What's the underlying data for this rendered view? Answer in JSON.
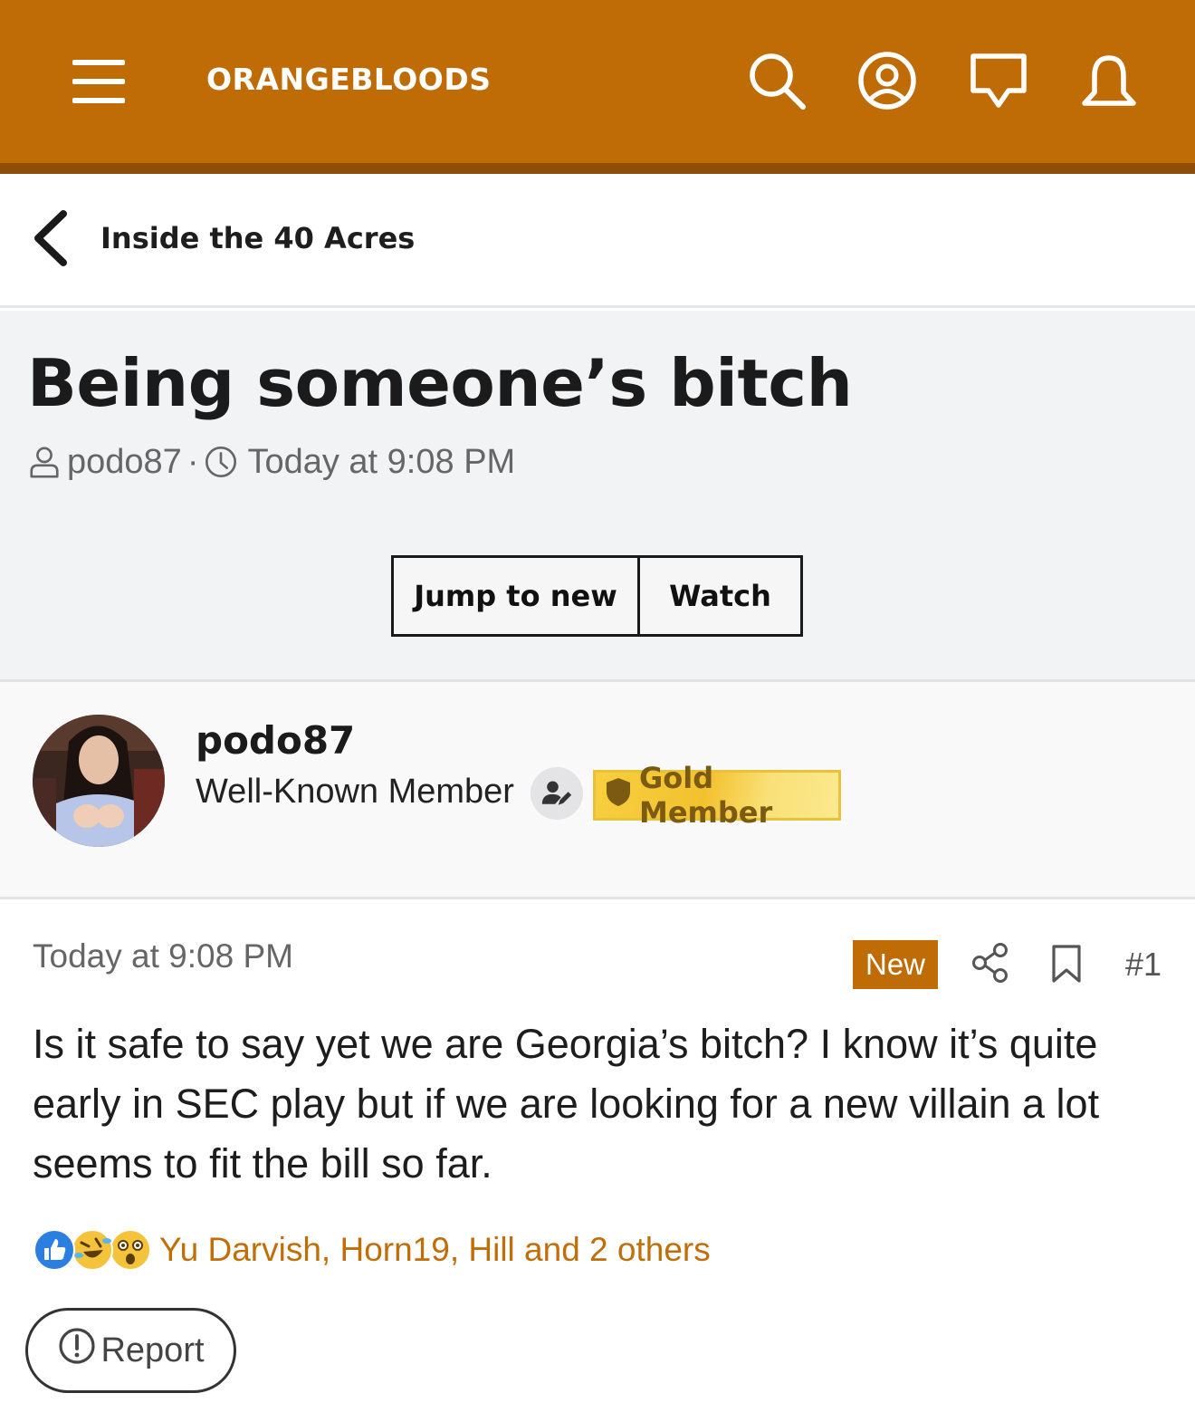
{
  "header": {
    "site_title": "ORANGEBLOODS",
    "icons": [
      "menu-icon",
      "search-icon",
      "account-icon",
      "messages-icon",
      "alerts-icon"
    ],
    "accent_color": "#bf6b06"
  },
  "breadcrumb": {
    "label": "Inside the 40 Acres"
  },
  "thread": {
    "title": "Being someone’s bitch",
    "author": "podo87",
    "separator": "·",
    "time": "Today at 9:08 PM",
    "buttons": {
      "jump_to_new": "Jump to new",
      "watch": "Watch"
    }
  },
  "author_block": {
    "name": "podo87",
    "title": "Well-Known Member",
    "badge": "Gold Member"
  },
  "post": {
    "date": "Today at 9:08 PM",
    "new_label": "New",
    "number": "#1",
    "body": "Is it safe to say yet we are Georgia’s bitch? I know it’s quite early in SEC play but if we are looking for a new villain a lot seems to fit the bill so far.",
    "reactions": {
      "icons": [
        "like-icon",
        "laugh-icon",
        "wow-icon"
      ],
      "text": "Yu Darvish, Horn19, Hill and 2 others"
    },
    "report_label": "Report"
  }
}
